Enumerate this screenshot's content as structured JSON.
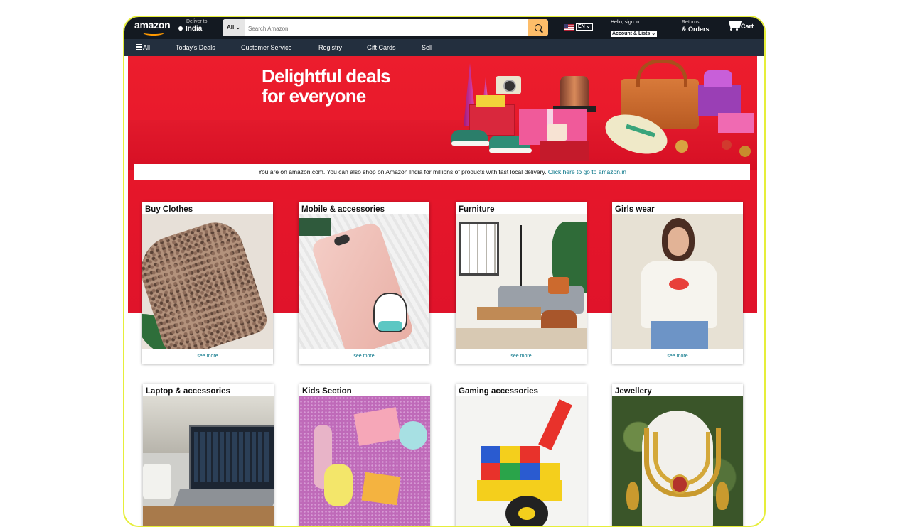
{
  "header": {
    "logo_text": "amazon",
    "deliver_to_label": "Deliver to",
    "deliver_to_location": "India",
    "search_category": "All",
    "search_placeholder": "Search Amazon",
    "language": "EN",
    "account_greeting": "Hello, sign in",
    "account_label": "Account & Lists",
    "returns_label": "Returns",
    "orders_label": "& Orders",
    "cart_label": "Cart"
  },
  "subnav": {
    "all_label": "All",
    "items": [
      "Today's Deals",
      "Customer Service",
      "Registry",
      "Gift Cards",
      "Sell"
    ]
  },
  "hero": {
    "title_line1": "Delightful deals",
    "title_line2": "for everyone"
  },
  "notice": {
    "text": "You are on amazon.com. You can also shop on Amazon India for millions of products with fast local delivery.",
    "link_text": "Click here to go to amazon.in"
  },
  "cards": [
    {
      "title": "Buy Clothes",
      "link": "see more"
    },
    {
      "title": "Mobile & accessories",
      "link": "see more"
    },
    {
      "title": "Furniture",
      "link": "see more"
    },
    {
      "title": "Girls wear",
      "link": "see more"
    },
    {
      "title": "Laptop & accessories",
      "link": ""
    },
    {
      "title": "Kids Section",
      "link": ""
    },
    {
      "title": "Gaming accessories",
      "link": ""
    },
    {
      "title": "Jewellery",
      "link": ""
    }
  ],
  "colors": {
    "nav_dark": "#131921",
    "nav_sub": "#232f3e",
    "search_button": "#febd69",
    "hero_red": "#e5162a",
    "link": "#007185",
    "frame_border": "#e6ee3a"
  }
}
